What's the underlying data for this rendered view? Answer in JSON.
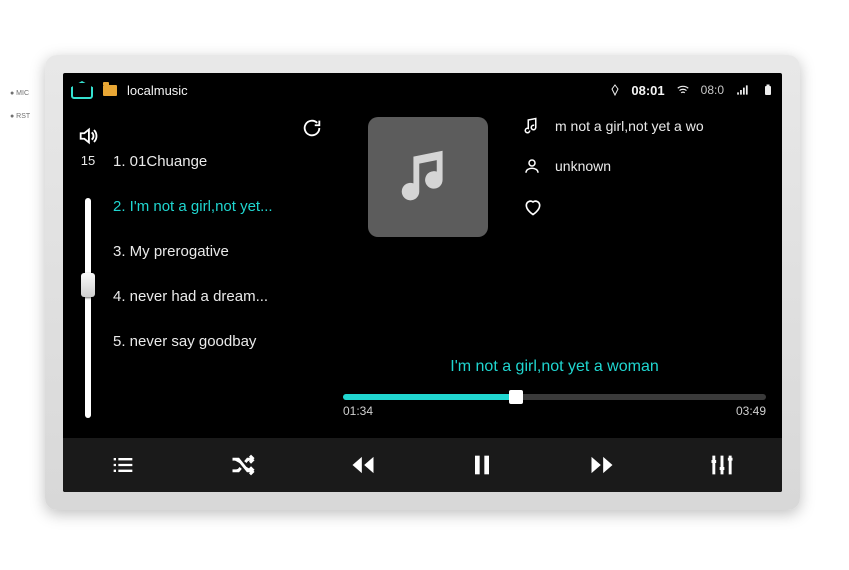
{
  "bezel": {
    "mic": "● MIC",
    "rst": "● RST"
  },
  "status": {
    "app_title": "localmusic",
    "clock": "08:01",
    "secondary_clock": "08:0"
  },
  "volume": {
    "label": "15",
    "percent": 55
  },
  "playlist": {
    "items": [
      {
        "n": "1.",
        "title": "01Chuange",
        "active": false
      },
      {
        "n": "2.",
        "title": "I'm not a girl,not yet...",
        "active": true
      },
      {
        "n": "3.",
        "title": "My prerogative",
        "active": false
      },
      {
        "n": "4.",
        "title": "never had a dream...",
        "active": false
      },
      {
        "n": "5.",
        "title": "never say goodbay",
        "active": false
      }
    ]
  },
  "meta": {
    "song": "m not a girl,not yet a wo",
    "artist": "unknown"
  },
  "now_playing": {
    "title": "I'm not a girl,not yet a woman",
    "elapsed": "01:34",
    "total": "03:49",
    "percent": 41
  },
  "icons": {
    "home": "home-icon",
    "folder": "folder-icon",
    "download": "download-icon",
    "wifi": "wifi-icon",
    "signal": "signal-icon",
    "battery": "battery-icon",
    "speaker": "speaker-icon",
    "refresh": "refresh-icon",
    "note": "music-note-icon",
    "person": "person-icon",
    "heart": "heart-icon",
    "list": "list-icon",
    "shuffle": "shuffle-icon",
    "prev": "previous-icon",
    "pause": "pause-icon",
    "next": "next-icon",
    "eq": "equalizer-icon"
  }
}
